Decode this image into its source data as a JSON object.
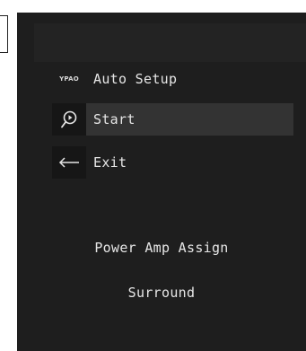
{
  "menu": {
    "title": {
      "label": "Auto Setup",
      "icon": "ypao-logo",
      "logo_text": "YPAO"
    },
    "items": [
      {
        "label": "Start",
        "icon": "microphone-icon",
        "selected": true
      },
      {
        "label": "Exit",
        "icon": "return-arrow-icon",
        "selected": false
      }
    ]
  },
  "status": {
    "line1": "Power Amp Assign",
    "line2": "Surround"
  },
  "colors": {
    "screen_bg": "#1e1e1e",
    "selected_bg": "#333333",
    "text": "#e6e6e6"
  }
}
